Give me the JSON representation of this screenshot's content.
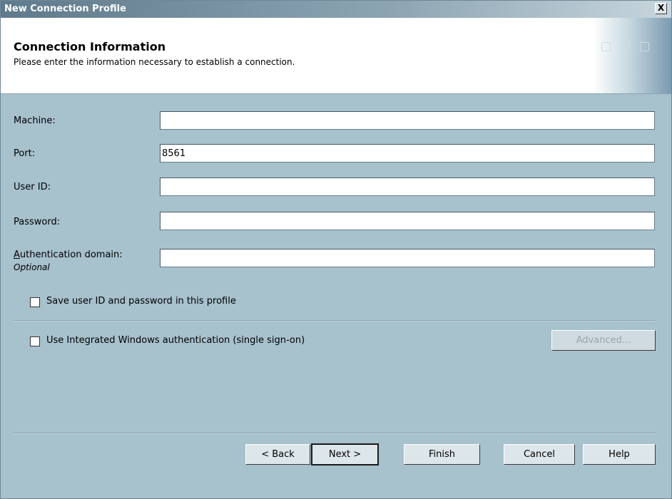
{
  "window": {
    "title": "New Connection Profile",
    "close_label": "X"
  },
  "header": {
    "title": "Connection Information",
    "subtitle": "Please enter the information necessary to establish a connection."
  },
  "fields": {
    "machine": {
      "label": "Machine:",
      "value": ""
    },
    "port": {
      "label": "Port:",
      "value": "8561"
    },
    "user_id": {
      "label": "User ID:",
      "value": ""
    },
    "password": {
      "label": "Password:",
      "value": ""
    },
    "auth_domain": {
      "label_accel": "A",
      "label_rest": "uthentication domain:",
      "hint": "Optional",
      "value": ""
    }
  },
  "checkboxes": {
    "save_credentials": {
      "label": "Save user ID and password in this profile",
      "checked": false
    },
    "integrated_windows": {
      "label": "Use Integrated Windows authentication (single sign-on)",
      "checked": false
    }
  },
  "buttons": {
    "advanced": "Advanced...",
    "back": "< Back",
    "next": "Next >",
    "finish": "Finish",
    "cancel": "Cancel",
    "help": "Help"
  },
  "colors": {
    "dialog_background": "#a7c1cd",
    "title_bar": "#5f7a8c",
    "header_background": "#ffffff"
  }
}
